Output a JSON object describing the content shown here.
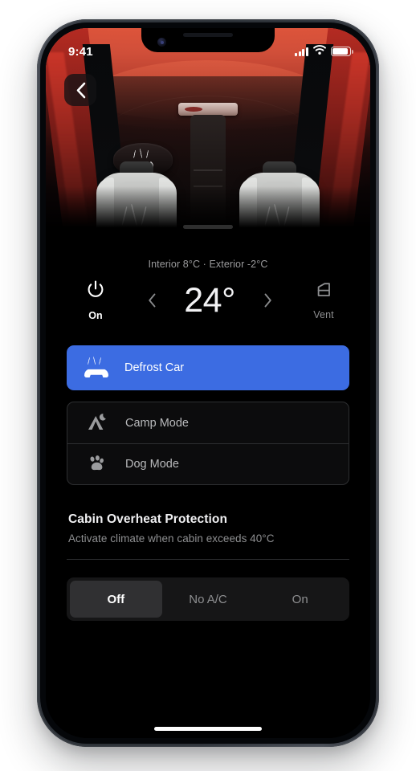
{
  "status_bar": {
    "time": "9:41",
    "signal_icon": "cellular-signal-icon",
    "wifi_icon": "wifi-icon",
    "battery_icon": "battery-icon"
  },
  "hero": {
    "back_icon": "chevron-left-icon",
    "alt": "car-interior-overhead-view",
    "seat_heat_icon": "heated-seat-icon",
    "wheel_heat_icon": "heated-steering-wheel-icon"
  },
  "climate": {
    "temps_line": "Interior 8°C · Exterior -2°C",
    "power": {
      "icon": "power-icon",
      "label": "On"
    },
    "decrease_icon": "chevron-left-icon",
    "increase_icon": "chevron-right-icon",
    "temperature": "24°",
    "vent": {
      "icon": "car-window-vent-icon",
      "label": "Vent"
    }
  },
  "defrost": {
    "icon": "defrost-car-icon",
    "label": "Defrost Car",
    "color": "#3c6ce2"
  },
  "modes": [
    {
      "icon": "tent-moon-icon",
      "label": "Camp Mode"
    },
    {
      "icon": "paw-print-icon",
      "label": "Dog Mode"
    }
  ],
  "overheat": {
    "title": "Cabin Overheat Protection",
    "subtitle": "Activate climate when cabin exceeds 40°C",
    "options": [
      {
        "label": "Off",
        "selected": true
      },
      {
        "label": "No A/C",
        "selected": false
      },
      {
        "label": "On",
        "selected": false
      }
    ]
  }
}
